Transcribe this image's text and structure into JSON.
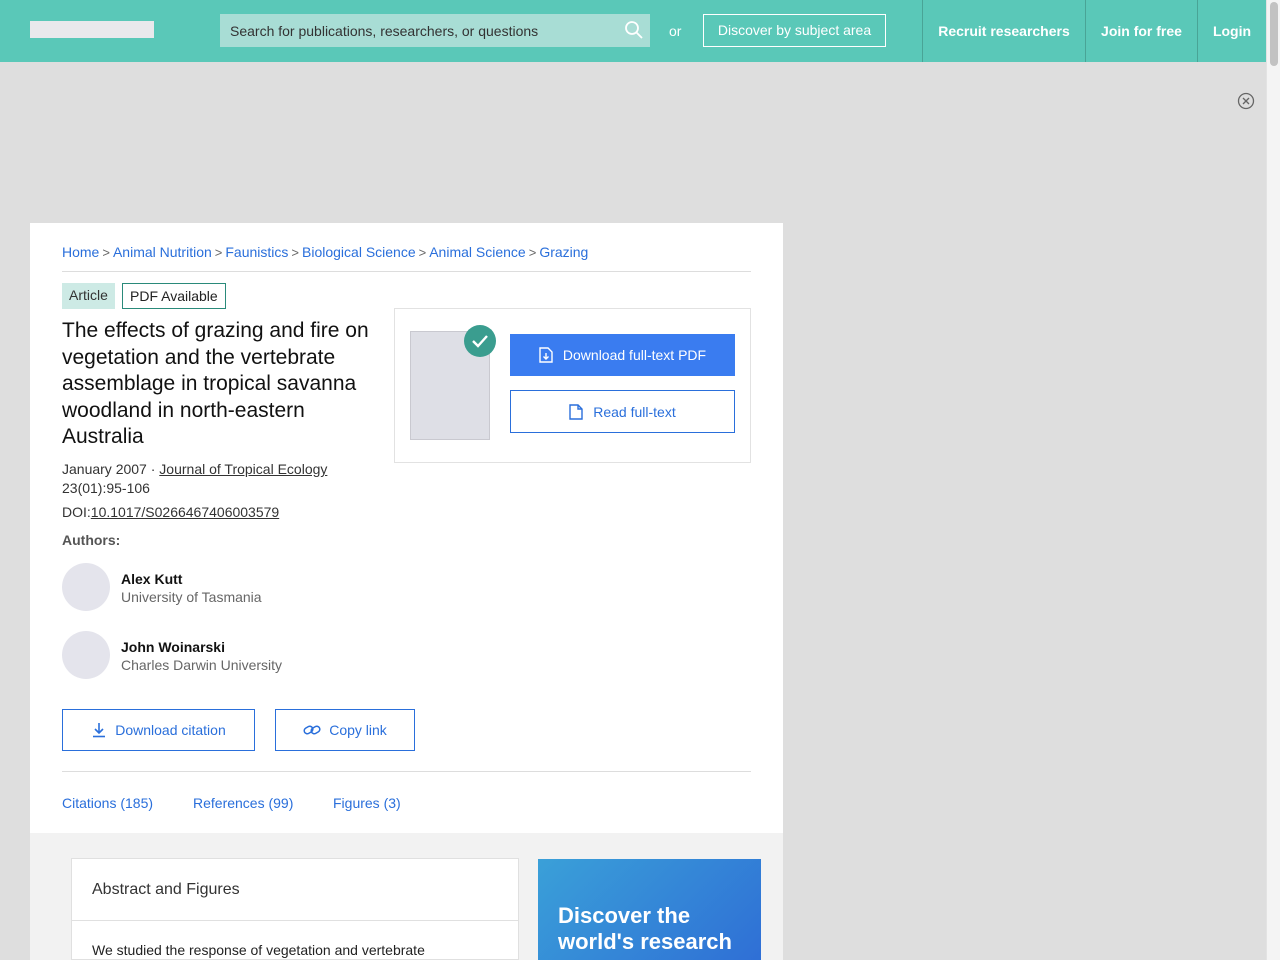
{
  "header": {
    "search_placeholder": "Search for publications, researchers, or questions",
    "or_text": "or",
    "discover_label": "Discover by subject area",
    "recruit_label": "Recruit researchers",
    "join_label": "Join for free",
    "login_label": "Login"
  },
  "breadcrumb": [
    "Home",
    "Animal Nutrition",
    "Faunistics",
    "Biological Science",
    "Animal Science",
    "Grazing"
  ],
  "badges": {
    "type": "Article",
    "pdf": "PDF Available"
  },
  "title": "The effects of grazing and fire on vegetation and the vertebrate assemblage in tropical savanna woodland in north-eastern Australia",
  "meta": {
    "date": "January 2007 · ",
    "journal": "Journal of Tropical Ecology",
    "volume": "23(01):95-106",
    "doi_label": "DOI:",
    "doi": "10.1017/S0266467406003579"
  },
  "authors_label": "Authors:",
  "authors": [
    {
      "name": "Alex Kutt",
      "institution": "University of Tasmania"
    },
    {
      "name": "John Woinarski",
      "institution": "Charles Darwin University"
    }
  ],
  "actions": {
    "download_citation": "Download citation",
    "copy_link": "Copy link",
    "download_pdf": "Download full-text PDF",
    "read_fulltext": "Read full-text"
  },
  "tabs": [
    "Citations (185)",
    "References (99)",
    "Figures (3)"
  ],
  "abstract": {
    "heading": "Abstract and Figures",
    "text": "We studied the response of vegetation and vertebrate"
  },
  "promo": {
    "text": "Discover the world's research"
  },
  "colors": {
    "header": "#5ac8b8",
    "link": "#2a6fdb",
    "primary_button": "#3a7cf0",
    "check": "#3a9d8f"
  }
}
